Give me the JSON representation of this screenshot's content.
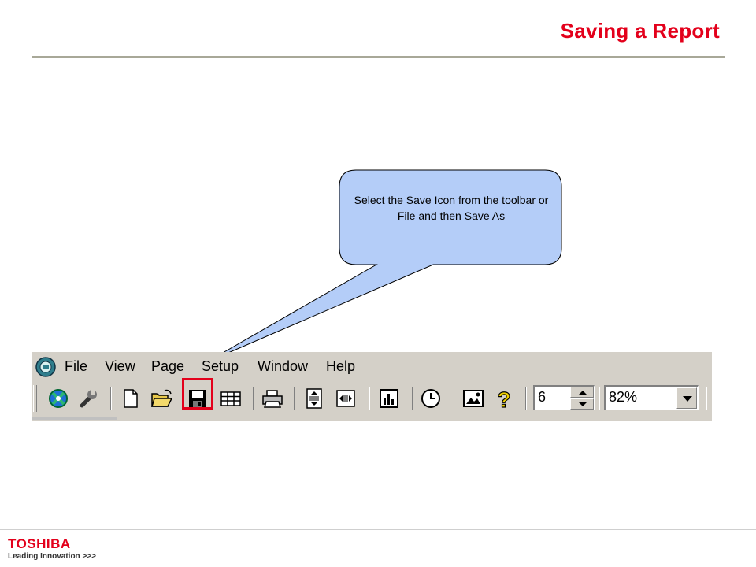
{
  "slide": {
    "title": "Saving a Report",
    "callout_text": "Select the Save Icon from the toolbar or File and then Save As"
  },
  "app": {
    "menu": [
      "File",
      "View",
      "Page",
      "Setup",
      "Window",
      "Help"
    ],
    "toolbar": {
      "buttons": [
        {
          "name": "navigator-icon"
        },
        {
          "name": "tools-icon"
        },
        {
          "name": "new-icon"
        },
        {
          "name": "open-folder-icon"
        },
        {
          "name": "save-icon"
        },
        {
          "name": "grid-icon"
        },
        {
          "name": "print-icon"
        },
        {
          "name": "fit-height-icon"
        },
        {
          "name": "fit-width-icon"
        },
        {
          "name": "chart-icon"
        },
        {
          "name": "clock-icon"
        },
        {
          "name": "image-icon"
        },
        {
          "name": "help-icon"
        }
      ],
      "page_spinner_value": "6",
      "zoom_value": "82%"
    }
  },
  "footer": {
    "brand": "TOSHIBA",
    "tagline": "Leading Innovation >>>"
  },
  "colors": {
    "accent": "#e3001b",
    "callout_fill": "#b4cdf8",
    "toolbar_bg": "#d4d0c8"
  }
}
